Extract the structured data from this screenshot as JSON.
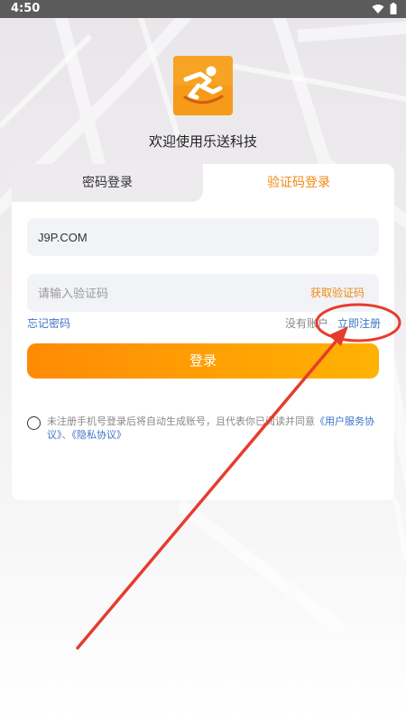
{
  "status_bar": {
    "time": "4:50",
    "icons": [
      "wifi-icon",
      "battery-icon"
    ]
  },
  "app": {
    "logo_icon": "running-man-logo",
    "welcome_text": "欢迎使用乐送科技"
  },
  "tabs": [
    {
      "label": "密码登录",
      "active": false
    },
    {
      "label": "验证码登录",
      "active": true
    }
  ],
  "form": {
    "phone_value": "J9P.COM",
    "code_placeholder": "请输入验证码",
    "get_code_label": "获取验证码",
    "forgot_password": "忘记密码",
    "no_account": "没有账户",
    "register_now": "立即注册",
    "login_button": "登录"
  },
  "agreement": {
    "prefix": "未注册手机号登录后将自动生成账号，且代表你已阅读并同意",
    "user_service": "《用户服务协议》",
    "separator": "、",
    "privacy": "《隐私协议》"
  },
  "colors": {
    "accent": "#f08a15",
    "link": "#3f73c9",
    "annotation": "#e63c2e"
  }
}
